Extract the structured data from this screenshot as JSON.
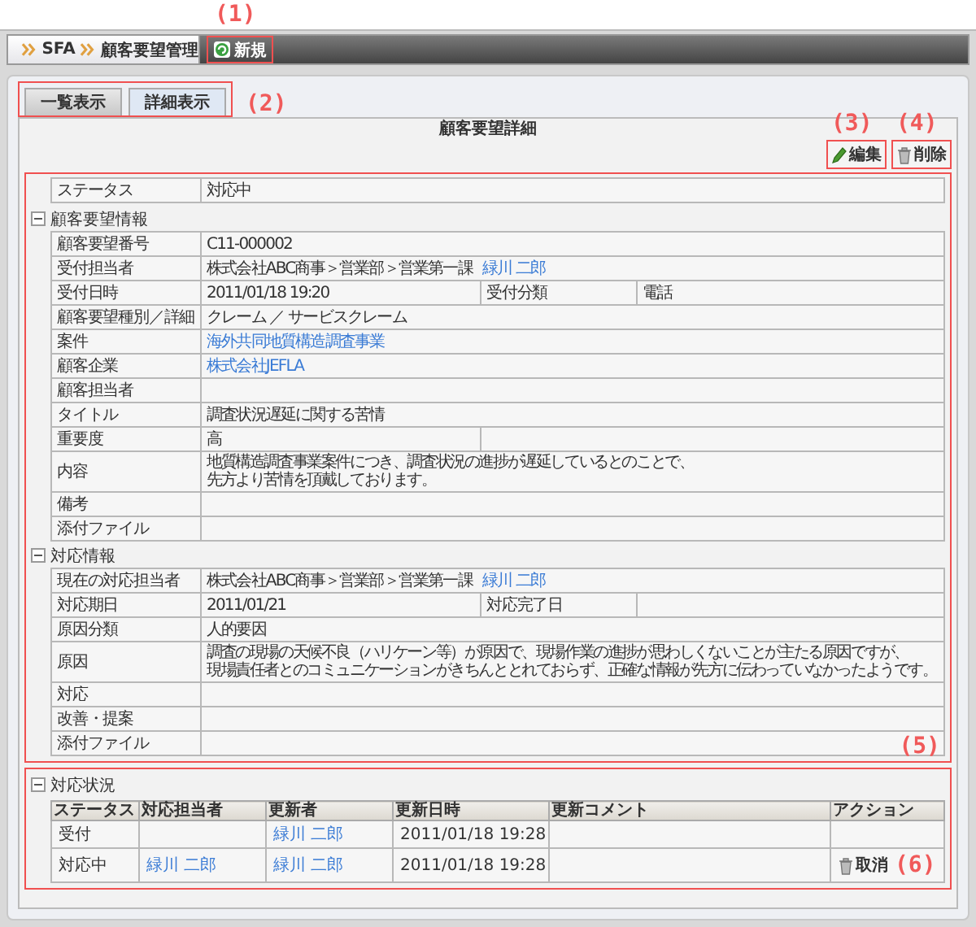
{
  "breadcrumb": [
    "SFA",
    "顧客要望管理"
  ],
  "new_button": {
    "label": "新規",
    "callout": "(1)"
  },
  "tabs_callout": "(2)",
  "tabs": [
    {
      "label": "一覧表示",
      "selected": false
    },
    {
      "label": "詳細表示",
      "selected": true
    }
  ],
  "panel_title": "顧客要望詳細",
  "actions": [
    {
      "label": "編集",
      "kind": "edit",
      "callout": "(3)"
    },
    {
      "label": "削除",
      "kind": "delete",
      "callout": "(4)"
    }
  ],
  "detail_callout": "(5)",
  "status_row": {
    "label": "ステータス",
    "value": "対応中"
  },
  "sections": [
    {
      "title": "顧客要望情報",
      "expanded": true,
      "rows": [
        {
          "fields": [
            {
              "kind": "label",
              "text": "顧客要望番号"
            },
            {
              "kind": "value",
              "text": "C11-000002"
            }
          ]
        },
        {
          "fields": [
            {
              "kind": "label",
              "text": "受付担当者"
            },
            {
              "kind": "value",
              "text": "株式会社ABC商事＞営業部＞営業第一課",
              "link": "緑川 二郎"
            }
          ]
        },
        {
          "fields": [
            {
              "kind": "label",
              "text": "受付日時"
            },
            {
              "kind": "value",
              "text": "2011/01/18 19:20"
            },
            {
              "kind": "label",
              "text": "受付分類"
            },
            {
              "kind": "value",
              "text": "電話"
            }
          ]
        },
        {
          "fields": [
            {
              "kind": "label",
              "text": "顧客要望種別／詳細"
            },
            {
              "kind": "value",
              "text": "クレーム ／ サービスクレーム"
            }
          ]
        },
        {
          "fields": [
            {
              "kind": "label",
              "text": "案件"
            },
            {
              "kind": "value",
              "link": "海外共同地質構造調査事業"
            }
          ]
        },
        {
          "fields": [
            {
              "kind": "label",
              "text": "顧客企業"
            },
            {
              "kind": "value",
              "link": "株式会社JEFLA"
            }
          ]
        },
        {
          "fields": [
            {
              "kind": "label",
              "text": "顧客担当者"
            },
            {
              "kind": "value"
            }
          ]
        },
        {
          "fields": [
            {
              "kind": "label",
              "text": "タイトル"
            },
            {
              "kind": "value",
              "text": "調査状況遅延に関する苦情"
            }
          ]
        },
        {
          "fields": [
            {
              "kind": "label",
              "text": "重要度"
            },
            {
              "kind": "value",
              "text": "高"
            },
            {
              "kind": "value"
            }
          ]
        },
        {
          "fields": [
            {
              "kind": "label",
              "text": "内容"
            },
            {
              "kind": "value",
              "lines": [
                "地質構造調査事業案件につき、調査状況の進捗が遅延しているとのことで、",
                "先方より苦情を頂戴しております。"
              ]
            }
          ]
        },
        {
          "fields": [
            {
              "kind": "label",
              "text": "備考"
            },
            {
              "kind": "value"
            }
          ]
        },
        {
          "fields": [
            {
              "kind": "label",
              "text": "添付ファイル"
            },
            {
              "kind": "value"
            }
          ]
        }
      ]
    },
    {
      "title": "対応情報",
      "expanded": true,
      "rows": [
        {
          "fields": [
            {
              "kind": "label",
              "text": "現在の対応担当者"
            },
            {
              "kind": "value",
              "text": "株式会社ABC商事＞営業部＞営業第一課",
              "link": "緑川 二郎"
            }
          ]
        },
        {
          "fields": [
            {
              "kind": "label",
              "text": "対応期日"
            },
            {
              "kind": "value",
              "text": "2011/01/21"
            },
            {
              "kind": "label",
              "text": "対応完了日"
            },
            {
              "kind": "value"
            }
          ]
        },
        {
          "fields": [
            {
              "kind": "label",
              "text": "原因分類"
            },
            {
              "kind": "value",
              "text": "人的要因"
            }
          ]
        },
        {
          "fields": [
            {
              "kind": "label",
              "text": "原因"
            },
            {
              "kind": "value",
              "lines": [
                "調査の現場の天候不良（ハリケーン等）が原因で、現場作業の進捗が思わしくないことが主たる原因ですが、",
                "現場責任者とのコミュニケーションがきちんととれておらず、正確な情報が先方に伝わっていなかったようです。"
              ]
            }
          ]
        },
        {
          "fields": [
            {
              "kind": "label",
              "text": "対応"
            },
            {
              "kind": "value"
            }
          ]
        },
        {
          "fields": [
            {
              "kind": "label",
              "text": "改善・提案"
            },
            {
              "kind": "value"
            }
          ]
        },
        {
          "fields": [
            {
              "kind": "label",
              "text": "添付ファイル"
            },
            {
              "kind": "value"
            }
          ]
        }
      ]
    }
  ],
  "history": {
    "title": "対応状況",
    "expanded": true,
    "columns": [
      "ステータス",
      "対応担当者",
      "更新者",
      "更新日時",
      "更新コメント",
      "アクション"
    ],
    "rows": [
      {
        "status": "受付",
        "updater": "緑川 二郎",
        "updated": "2011/01/18 19:28"
      },
      {
        "status": "対応中",
        "assignee": "緑川 二郎",
        "updater": "緑川 二郎",
        "updated": "2011/01/18 19:28",
        "action": {
          "label": "取消",
          "callout": "(6)"
        }
      }
    ]
  }
}
